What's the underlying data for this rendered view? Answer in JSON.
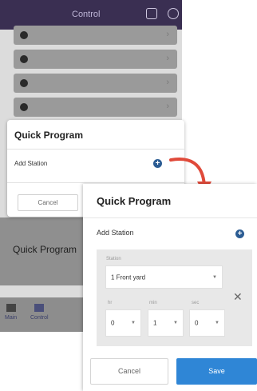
{
  "app": {
    "title": "Control",
    "background_list_rows": 4
  },
  "background": {
    "quick_program_label": "Quick Program",
    "nav": [
      {
        "label": "Main"
      },
      {
        "label": "Control"
      }
    ]
  },
  "modal_small": {
    "title": "Quick Program",
    "add_station_label": "Add Station",
    "cancel_label": "Cancel"
  },
  "modal_large": {
    "title": "Quick Program",
    "add_station_label": "Add Station",
    "station": {
      "label": "Station",
      "value": "1 Front yard"
    },
    "duration": {
      "hr": {
        "label": "hr",
        "value": "0"
      },
      "min": {
        "label": "min",
        "value": "1"
      },
      "sec": {
        "label": "sec",
        "value": "0"
      }
    },
    "cancel_label": "Cancel",
    "save_label": "Save"
  },
  "colors": {
    "topbar": "#3a2f52",
    "accent": "#2f86d6",
    "add_icon": "#2b5c93",
    "arrow": "#e04a3a"
  },
  "icons": [
    "add-circle-icon",
    "remove-x-icon",
    "dropdown-arrow-icon",
    "curved-arrow-icon"
  ]
}
